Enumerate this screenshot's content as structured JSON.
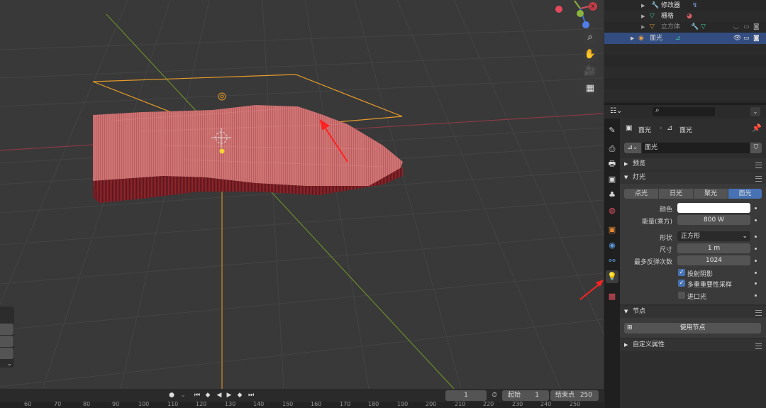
{
  "outliner": {
    "rows": [
      {
        "label": "修改器"
      },
      {
        "label": "栅格"
      },
      {
        "label": "立方体"
      },
      {
        "label": "面光"
      }
    ]
  },
  "properties": {
    "search_placeholder": "",
    "breadcrumb": {
      "object": "面光",
      "data": "面光"
    },
    "datablock_name": "面光",
    "sections": {
      "preview": "预览",
      "light": "灯光",
      "nodes": "节点",
      "custom": "自定义属性"
    },
    "light_types": [
      "点光",
      "日光",
      "聚光",
      "面光"
    ],
    "active_light_type": "面光",
    "color_label": "颜色",
    "energy_label": "能量(乘方)",
    "energy_value": "800 W",
    "shape_label": "形状",
    "shape_value": "正方形",
    "size_label": "尺寸",
    "size_value": "1 m",
    "bounces_label": "最多反弹次数",
    "bounces_value": "1024",
    "checkboxes": [
      {
        "label": "投射阴影",
        "checked": true
      },
      {
        "label": "多重重要性采样",
        "checked": true
      },
      {
        "label": "进口光",
        "checked": false
      }
    ],
    "use_nodes_label": "使用节点",
    "colors": {
      "light_color": "#ffffff",
      "accent": "#4772b3"
    }
  },
  "timeline": {
    "current_frame": "1",
    "start_label": "起始",
    "start_value": "1",
    "end_label": "结束点",
    "end_value": "250",
    "ruler": [
      "60",
      "70",
      "80",
      "90",
      "100",
      "110",
      "120",
      "130",
      "140",
      "150",
      "160",
      "170",
      "180",
      "190",
      "200",
      "210",
      "220",
      "230",
      "240",
      "250"
    ]
  }
}
